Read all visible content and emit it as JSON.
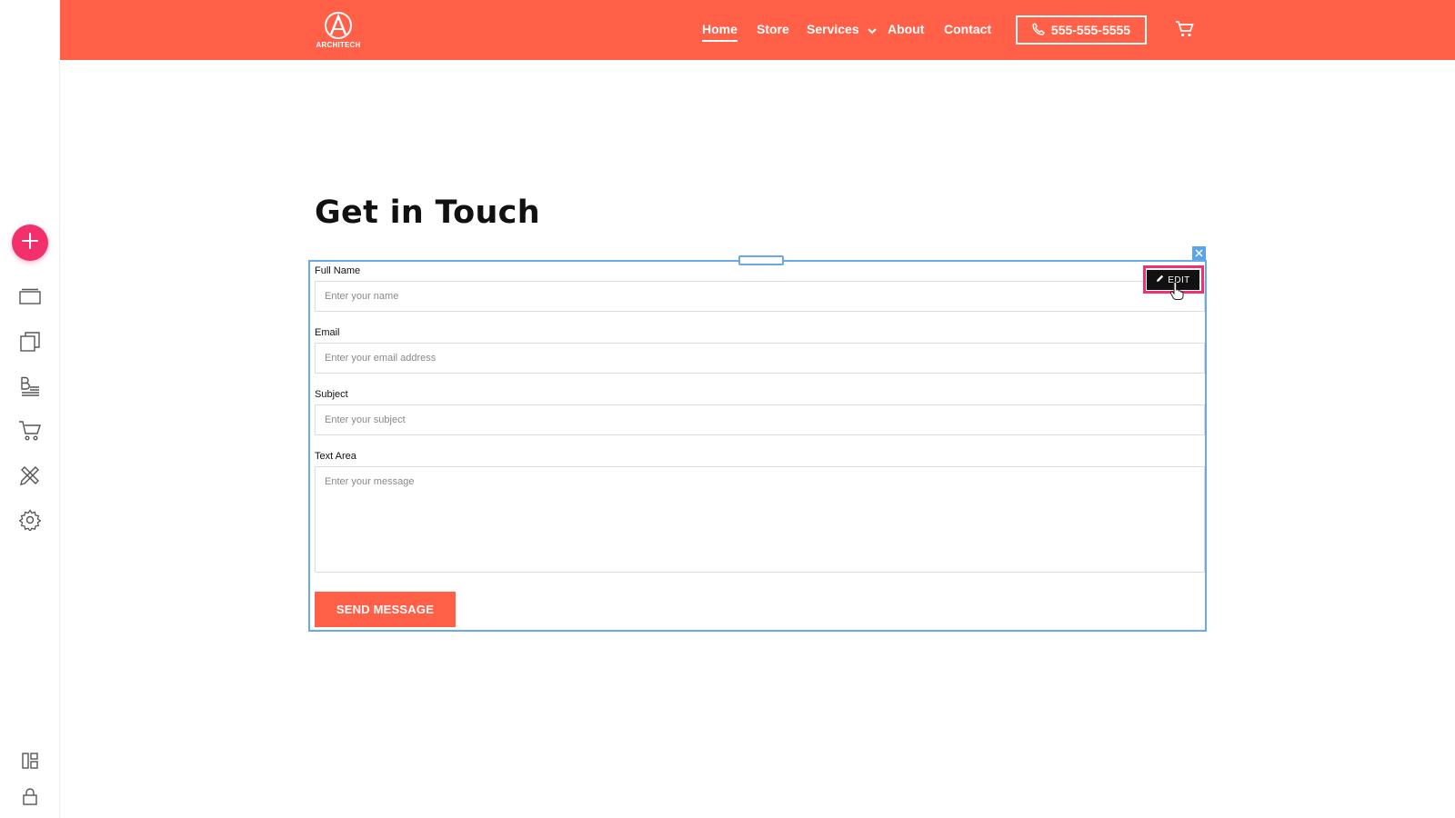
{
  "editor": {
    "left_tools": [
      {
        "name": "add-icon"
      },
      {
        "name": "pages-icon"
      },
      {
        "name": "layers-icon"
      },
      {
        "name": "blog-icon"
      },
      {
        "name": "store-cart-icon"
      },
      {
        "name": "design-tools-icon"
      },
      {
        "name": "settings-gear-icon"
      },
      {
        "name": "layout-icon"
      },
      {
        "name": "lock-icon"
      }
    ],
    "accent_color": "#f2306b",
    "selection_color": "#6aa9e8"
  },
  "header": {
    "brand_color": "#ff6047",
    "logo_text": "ARCHITECH",
    "nav": [
      {
        "label": "Home",
        "active": true
      },
      {
        "label": "Store",
        "active": false
      },
      {
        "label": "Services",
        "active": false
      },
      {
        "label": "About",
        "active": false
      },
      {
        "label": "Contact",
        "active": false
      }
    ],
    "phone": "555-555-5555"
  },
  "main": {
    "title": "Get in Touch",
    "edit_label": "EDIT",
    "form": {
      "fields": [
        {
          "label": "Full Name",
          "placeholder": "Enter your name"
        },
        {
          "label": "Email",
          "placeholder": "Enter your email address"
        },
        {
          "label": "Subject",
          "placeholder": "Enter your subject"
        },
        {
          "label": "Text Area",
          "placeholder": "Enter your message"
        }
      ],
      "submit_label": "SEND MESSAGE"
    }
  }
}
